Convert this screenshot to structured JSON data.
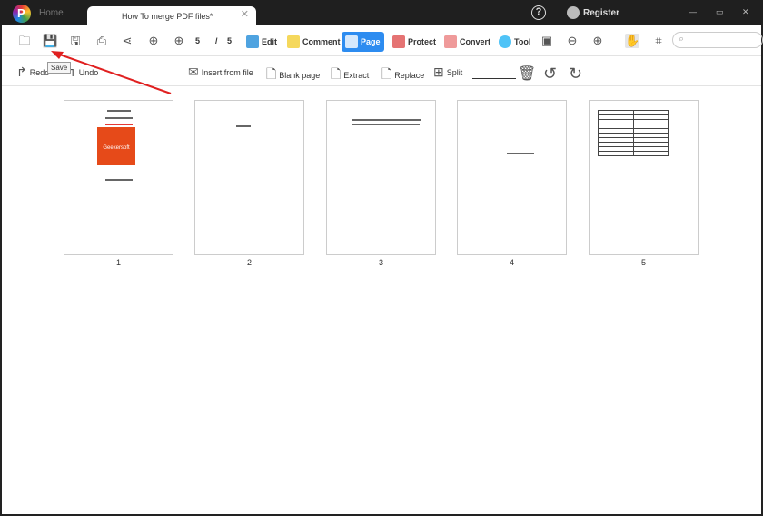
{
  "titlebar": {
    "home": "Home",
    "tab_title": "How To merge PDF files*",
    "help": "?",
    "register": "Register"
  },
  "toolbar": {
    "current_page": "5",
    "separator": "/",
    "total_pages": "5"
  },
  "module_tabs": [
    {
      "label": "Edit",
      "color": "#4fa3e0"
    },
    {
      "label": "Comment",
      "color": "#f5d85c"
    },
    {
      "label": "Page",
      "color": "#2d8cf0",
      "active": true
    },
    {
      "label": "Protect",
      "color": "#e57373"
    },
    {
      "label": "Convert",
      "color": "#e57373"
    },
    {
      "label": "Tool",
      "color": "#4fc3f7"
    }
  ],
  "page_toolbar": {
    "redo": "Redo",
    "undo": "Undo",
    "insert": "Insert from file",
    "blank": "Blank page",
    "extract": "Extract",
    "replace": "Replace",
    "split": "Split"
  },
  "tooltip": "Save",
  "pages": [
    {
      "number": "1",
      "logo_text": "Geekersoft"
    },
    {
      "number": "2"
    },
    {
      "number": "3"
    },
    {
      "number": "4"
    },
    {
      "number": "5"
    }
  ],
  "annotation_color": "#e02020"
}
